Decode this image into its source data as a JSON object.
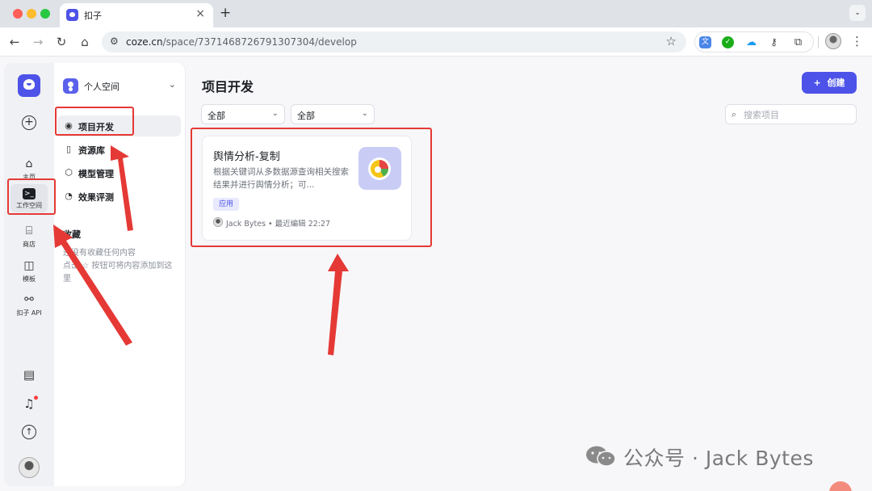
{
  "browser": {
    "tab_title": "扣子",
    "url_domain": "coze.cn",
    "url_path": "/space/7371468726791307304/develop"
  },
  "rail": {
    "items": [
      {
        "label": "主页",
        "icon": "home-icon"
      },
      {
        "label": "工作空间",
        "icon": "workspace-icon"
      },
      {
        "label": "商店",
        "icon": "store-icon"
      },
      {
        "label": "模板",
        "icon": "template-icon"
      },
      {
        "label": "扣子 API",
        "icon": "api-icon"
      }
    ]
  },
  "sidebar": {
    "space_label": "个人空间",
    "items": [
      {
        "label": "项目开发",
        "icon": "bot-icon"
      },
      {
        "label": "资源库",
        "icon": "library-icon"
      },
      {
        "label": "模型管理",
        "icon": "cube-icon"
      },
      {
        "label": "效果评测",
        "icon": "gauge-icon"
      }
    ],
    "favorites_title": "收藏",
    "favorites_empty": "还没有收藏任何内容\n点击 ☆ 按钮可将内容添加到这里"
  },
  "main": {
    "title": "项目开发",
    "create_label": "创建",
    "filter1": "全部",
    "filter2": "全部",
    "search_placeholder": "搜索项目"
  },
  "card": {
    "title": "舆情分析-复制",
    "description": "根据关键词从多数据源查询相关搜索结果并进行舆情分析；可...",
    "tag": "应用",
    "author": "Jack Bytes",
    "meta": "Jack Bytes • 最近编辑 22:27"
  },
  "watermark": {
    "text": "公众号 · Jack Bytes"
  },
  "colors": {
    "brand": "#4d53e8",
    "annotation": "#e53935"
  }
}
